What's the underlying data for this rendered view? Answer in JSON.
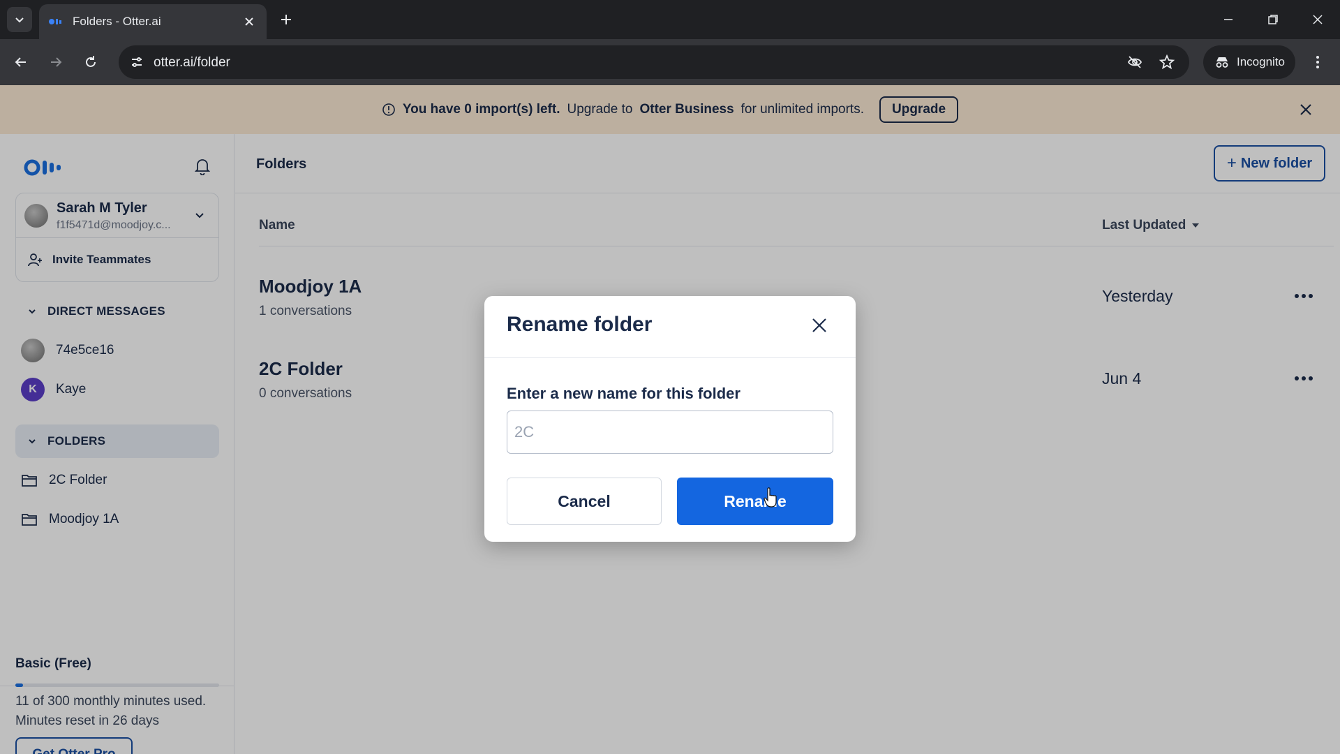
{
  "browser": {
    "tab_title": "Folders - Otter.ai",
    "url": "otter.ai/folder",
    "incognito_label": "Incognito"
  },
  "banner": {
    "text_bold": "You have 0 import(s) left.",
    "text_mid": "Upgrade to",
    "text_brand": "Otter Business",
    "text_end": "for unlimited imports.",
    "button": "Upgrade"
  },
  "sidebar": {
    "user": {
      "name": "Sarah M Tyler",
      "email": "f1f5471d@moodjoy.c..."
    },
    "invite_label": "Invite Teammates",
    "dm_heading": "DIRECT MESSAGES",
    "dms": [
      {
        "label": "74e5ce16"
      },
      {
        "label": "Kaye",
        "initial": "K"
      }
    ],
    "folders_heading": "FOLDERS",
    "folders": [
      {
        "label": "2C Folder"
      },
      {
        "label": "Moodjoy 1A"
      }
    ],
    "plan": {
      "title": "Basic (Free)",
      "minutes_used": 11,
      "minutes_total": 300,
      "usage_fraction": 0.037,
      "line1": "11 of 300 monthly minutes used.",
      "line2": "Minutes reset in 26 days",
      "button": "Get Otter Pro"
    }
  },
  "main": {
    "title": "Folders",
    "new_folder_label": "New folder",
    "columns": {
      "name": "Name",
      "updated": "Last Updated"
    },
    "folders": [
      {
        "name": "Moodjoy 1A",
        "count": "1 conversations",
        "updated": "Yesterday"
      },
      {
        "name": "2C Folder",
        "count": "0 conversations",
        "updated": "Jun 4"
      }
    ]
  },
  "modal": {
    "title": "Rename folder",
    "label": "Enter a new name for this folder",
    "input_placeholder": "2C",
    "cancel": "Cancel",
    "confirm": "Rename"
  },
  "colors": {
    "brand_blue": "#1466e0",
    "navy": "#1b2b4a",
    "banner_bg": "#fbead5",
    "kaye_avatar": "#5b3ec8"
  }
}
